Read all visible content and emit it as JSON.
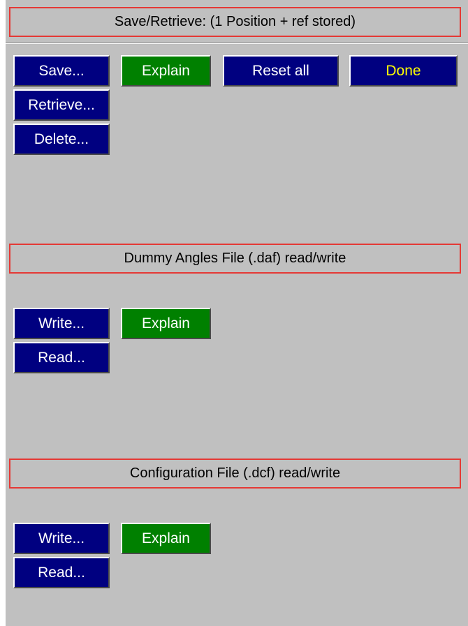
{
  "colors": {
    "panel_bg": "#c0c0c0",
    "header_border": "#e53935",
    "button_blue": "#000080",
    "button_green": "#008000",
    "button_text": "#ffffff",
    "done_text": "#ffff00"
  },
  "save_section": {
    "title": "Save/Retrieve: (1 Position + ref stored)",
    "save_label": "Save...",
    "explain_label": "Explain",
    "reset_label": "Reset all",
    "done_label": "Done",
    "retrieve_label": "Retrieve...",
    "delete_label": "Delete..."
  },
  "daf_section": {
    "title": "Dummy Angles File (.daf) read/write",
    "write_label": "Write...",
    "explain_label": "Explain",
    "read_label": "Read..."
  },
  "dcf_section": {
    "title": "Configuration File (.dcf) read/write",
    "write_label": "Write...",
    "explain_label": "Explain",
    "read_label": "Read..."
  }
}
